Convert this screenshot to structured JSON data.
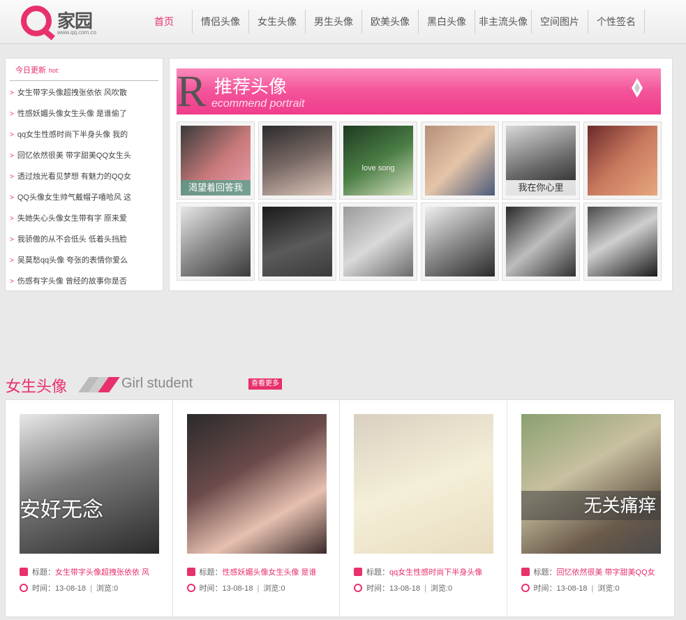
{
  "header": {
    "logo_text": "家园",
    "logo_sub": "www.qq.com.co",
    "nav": [
      "首页",
      "情侣头像",
      "女生头像",
      "男生头像",
      "欧美头像",
      "黑白头像",
      "非主流头像",
      "空间图片",
      "个性签名"
    ]
  },
  "left": {
    "title": "今日更新",
    "hot": "hot:",
    "items": [
      "女生带字头像超拽张依依 风吹散",
      "性感妖媚头像女生头像 是谁偷了",
      "qq女生性感时尚下半身头像 我的",
      "回忆依然很美 带字甜美QQ女生头",
      "透过烛光看见梦想 有魅力的QQ女",
      "QQ头像女生帅气戴帽子嘻哈风 这",
      "失她失心头像女生带有字 原来爱",
      "我骄傲的从不会低头 低着头挡脸",
      "吴莫愁qq头像 夸张的表情你爱么",
      "伤感有字头像 曾经的故事你是否"
    ]
  },
  "recommend": {
    "big_letter": "R",
    "title": "推荐头像",
    "subtitle": "ecommend portrait",
    "thumbs": [
      {
        "caption": "渴望着回答我",
        "style": "green"
      },
      {
        "caption": ""
      },
      {
        "caption": "love song",
        "style": "plain"
      },
      {
        "caption": ""
      },
      {
        "caption": "我在你心里",
        "style": "white"
      },
      {
        "caption": ""
      },
      {
        "caption": ""
      },
      {
        "caption": ""
      },
      {
        "caption": ""
      },
      {
        "caption": ""
      },
      {
        "caption": ""
      },
      {
        "caption": ""
      }
    ]
  },
  "girls": {
    "title": "女生头像",
    "subtitle": "Girl student",
    "more": "查看更多",
    "title_prefix": "标题：",
    "time_prefix": "时间：",
    "views_prefix": "浏览:",
    "cards": [
      {
        "caption": "安好无念",
        "title": "女生带字头像超拽张依依 风",
        "time": "13-08-18",
        "views": "0"
      },
      {
        "caption": "",
        "title": "性感妖媚头像女生头像 是谁",
        "time": "13-08-18",
        "views": "0"
      },
      {
        "caption": "",
        "title": "qq女生性感时尚下半身头像",
        "time": "13-08-18",
        "views": "0"
      },
      {
        "caption": "无关痛痒",
        "title": "回忆依然很美 带字甜美QQ女",
        "time": "13-08-18",
        "views": "0"
      }
    ]
  },
  "colors": {
    "accent": "#e8306a",
    "banner": "#f4539a"
  }
}
